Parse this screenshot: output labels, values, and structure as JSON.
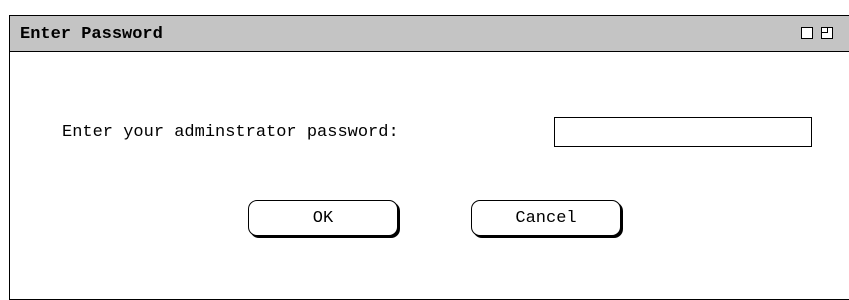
{
  "window": {
    "title": "Enter Password"
  },
  "prompt": {
    "label": "Enter your adminstrator password:",
    "field_value": ""
  },
  "buttons": {
    "ok_label": "OK",
    "cancel_label": "Cancel"
  },
  "icons": {
    "maximize": "maximize-icon",
    "restore": "restore-icon"
  },
  "colors": {
    "titlebar": "#c4c4c4",
    "background": "#ffffff",
    "border": "#000000"
  }
}
